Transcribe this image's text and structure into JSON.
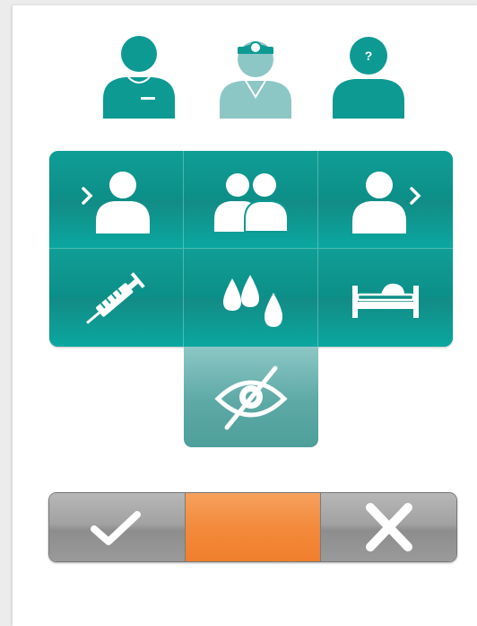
{
  "roles": {
    "unknown_badge": "?"
  },
  "colors": {
    "teal": "#0c9a93",
    "teal_light": "#8cc7c5",
    "orange": "#f38a3c",
    "gray": "#a2a2a2",
    "white": "#ffffff"
  },
  "icons": {
    "roles": [
      "nurse-icon",
      "doctor-icon",
      "unknown-person-icon"
    ],
    "grid": [
      "admit-patient-icon",
      "group-icon",
      "discharge-patient-icon",
      "syringe-icon",
      "fluids-icon",
      "bed-icon"
    ],
    "hide": "eye-off-icon",
    "actions": [
      "checkmark-icon",
      "x-icon"
    ]
  }
}
